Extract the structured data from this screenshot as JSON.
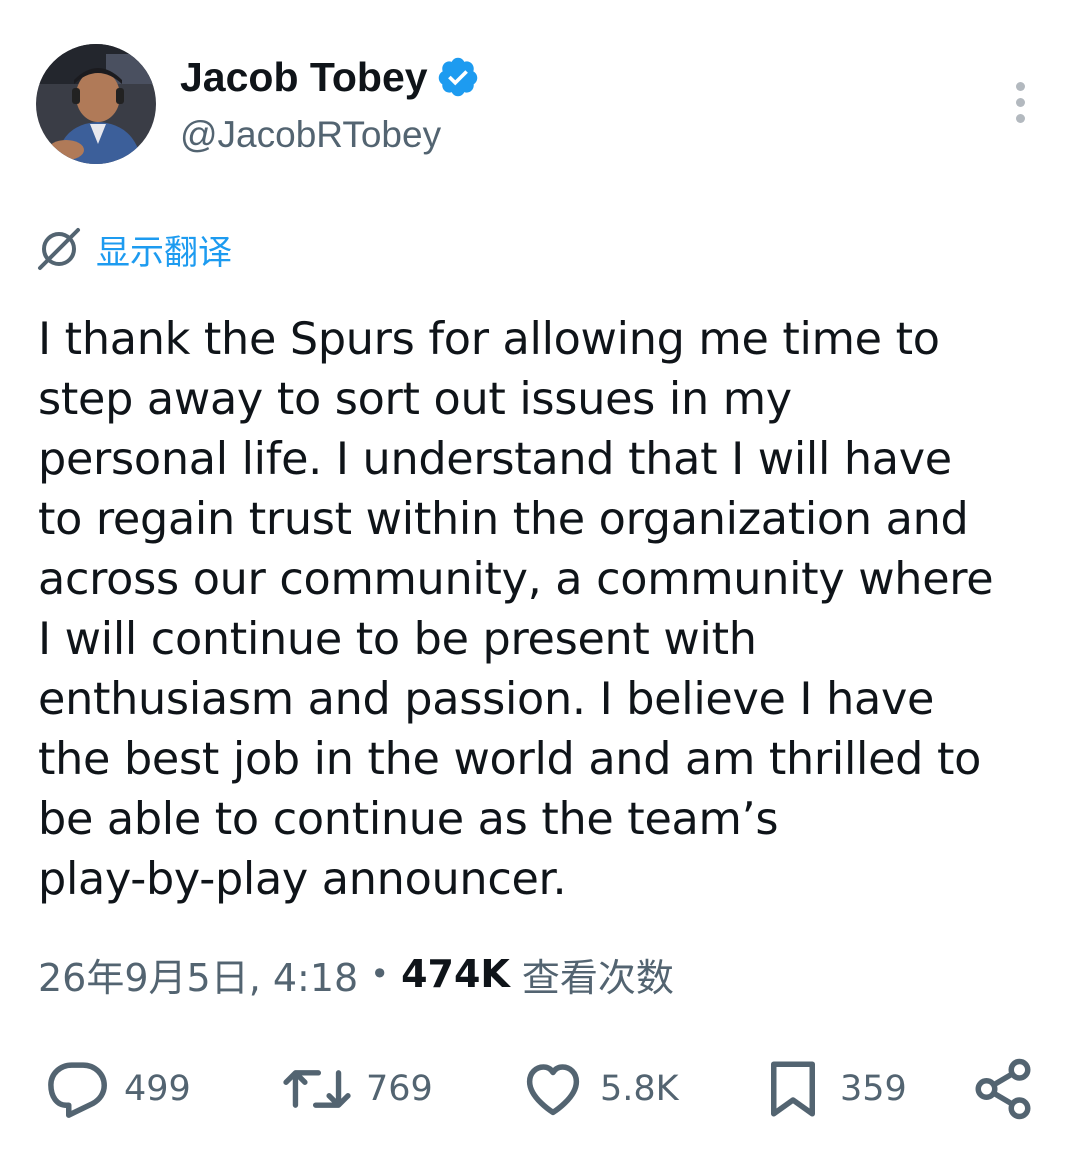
{
  "author": {
    "name": "Jacob Tobey",
    "handle": "@JacobRTobey",
    "verified": true,
    "avatar_icon": "profile-photo"
  },
  "translate": {
    "label": "显示翻译",
    "icon": "globe-slash-icon"
  },
  "tweet": {
    "text": "I thank the Spurs for allowing me time to\nstep away to sort out issues in my\npersonal life. I understand that I will have\nto regain trust within the organization and\nacross our community, a community where\nI will continue to be present with\nenthusiasm and passion. I believe I have\nthe best job in the world and am thrilled to\nbe able to continue as the team’s\nplay-by-play announcer."
  },
  "meta": {
    "timestamp": "26年9月5日, 4:18",
    "separator": "•",
    "views_count": "474K",
    "views_label": "查看次数"
  },
  "actions": {
    "replies": "499",
    "retweets": "769",
    "likes": "5.8K",
    "bookmarks": "359"
  },
  "colors": {
    "accent": "#1d9bf0",
    "text": "#0f1419",
    "secondary": "#536471"
  }
}
